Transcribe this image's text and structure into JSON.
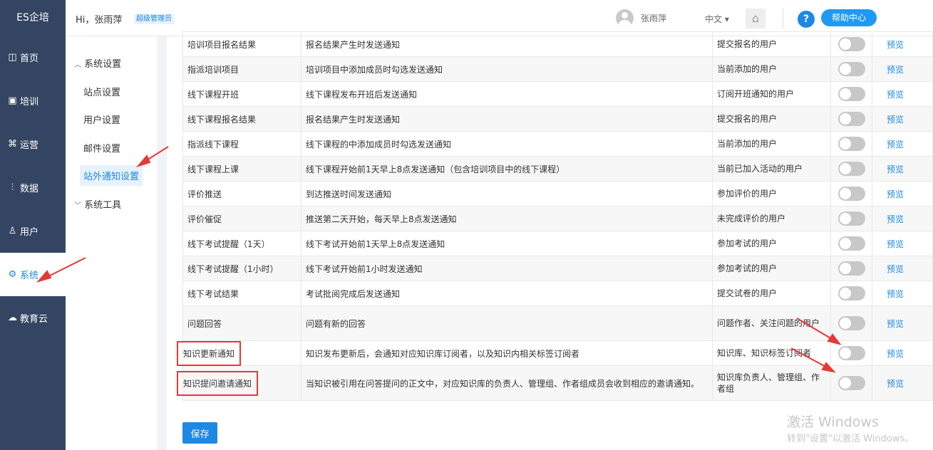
{
  "app": {
    "logo": "ES企培"
  },
  "sidebar": {
    "items": [
      {
        "label": "首页",
        "icon": "dashboard-icon",
        "glyph": "◫"
      },
      {
        "label": "培训",
        "icon": "training-icon",
        "glyph": "▣"
      },
      {
        "label": "运营",
        "icon": "operations-icon",
        "glyph": "⌘"
      },
      {
        "label": "数据",
        "icon": "chart-icon",
        "glyph": "⫶"
      },
      {
        "label": "用户",
        "icon": "user-icon",
        "glyph": "♙"
      },
      {
        "label": "系统",
        "icon": "gear-icon",
        "glyph": "⚙"
      },
      {
        "label": "教育云",
        "icon": "cloud-icon",
        "glyph": "☁"
      }
    ]
  },
  "header": {
    "greeting": "Hi，张雨萍",
    "role_badge": "超级管理员",
    "username": "张雨萍",
    "language": "中文 ▾",
    "help_label": "帮助中心"
  },
  "submenu": {
    "group1": "系统设置",
    "items": [
      "站点设置",
      "用户设置",
      "邮件设置",
      "站外通知设置"
    ],
    "group2": "系统工具"
  },
  "table": {
    "preview_label": "预览",
    "rows": [
      {
        "name": "培训项目报名结果",
        "desc": "报名结果产生时发送通知",
        "target": "提交报名的用户",
        "enabled": false
      },
      {
        "name": "指派培训项目",
        "desc": "培训项目中添加成员时勾选发送通知",
        "target": "当前添加的用户",
        "enabled": false
      },
      {
        "name": "线下课程开班",
        "desc": "线下课程发布开班后发送通知",
        "target": "订阅开班通知的用户",
        "enabled": false
      },
      {
        "name": "线下课程报名结果",
        "desc": "报名结果产生时发送通知",
        "target": "提交报名的用户",
        "enabled": false
      },
      {
        "name": "指派线下课程",
        "desc": "线下课程的中添加成员时勾选发送通知",
        "target": "当前添加的用户",
        "enabled": false
      },
      {
        "name": "线下课程上课",
        "desc": "线下课程开始前1天早上8点发送通知（包含培训项目中的线下课程）",
        "target": "当前已加入活动的用户",
        "enabled": false
      },
      {
        "name": "评价推送",
        "desc": "到达推送时间发送通知",
        "target": "参加评价的用户",
        "enabled": false
      },
      {
        "name": "评价催促",
        "desc": "推送第二天开始，每天早上8点发送通知",
        "target": "未完成评价的用户",
        "enabled": false
      },
      {
        "name": "线下考试提醒（1天）",
        "desc": "线下考试开始前1天早上8点发送通知",
        "target": "参加考试的用户",
        "enabled": false
      },
      {
        "name": "线下考试提醒（1小时）",
        "desc": "线下考试开始前1小时发送通知",
        "target": "参加考试的用户",
        "enabled": false
      },
      {
        "name": "线下考试结果",
        "desc": "考试批阅完成后发送通知",
        "target": "提交试卷的用户",
        "enabled": false
      },
      {
        "name": "问题回答",
        "desc": "问题有新的回答",
        "target": "问题作者、关注问题的用户",
        "enabled": false
      },
      {
        "name": "知识更新通知",
        "desc": "知识发布更新后，会通知对应知识库订阅者，以及知识内相关标签订阅者",
        "target": "知识库、知识标签订阅者",
        "enabled": false
      },
      {
        "name": "知识提问邀请通知",
        "desc": "当知识被引用在问答提问的正文中，对应知识库的负责人、管理组、作者组成员会收到相应的邀请通知。",
        "target": "知识库负责人、管理组、作者组",
        "enabled": false
      }
    ]
  },
  "actions": {
    "save_label": "保存"
  },
  "watermark": {
    "line1": "激活 Windows",
    "line2": "转到\"设置\"以激活 Windows。"
  },
  "colors": {
    "sidebar": "#344563",
    "accent": "#1e88e5",
    "annotation": "#e53935"
  }
}
